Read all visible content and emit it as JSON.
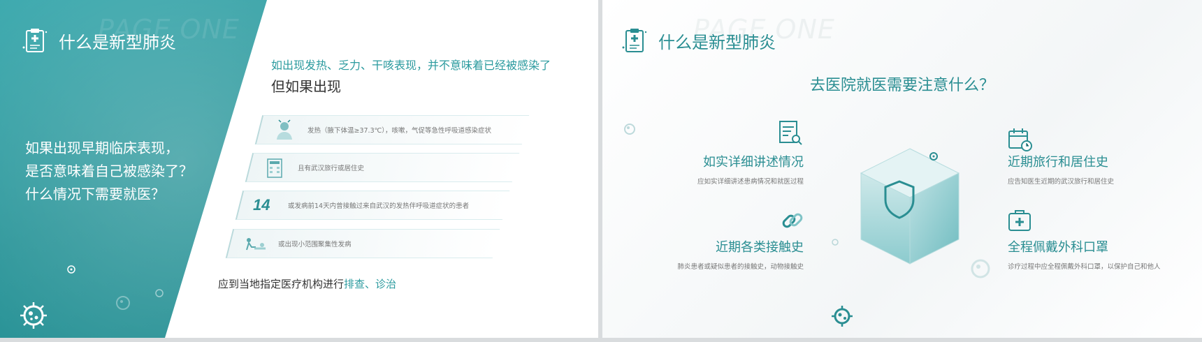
{
  "slide1": {
    "ghost": "PAGE ONE",
    "title": "什么是新型肺炎",
    "question_lines": [
      "如果出现早期临床表现，",
      "是否意味着自己被感染了？",
      "什么情况下需要就医？"
    ],
    "lead_line1": "如出现发热、乏力、干咳表现，并不意味着已经被感染了",
    "lead_line2": "但如果出现",
    "symptoms": [
      {
        "icon": "fever-person-icon",
        "text": "发热（腋下体温≥37.3℃），咳嗽，气促等急性呼吸道感染症状"
      },
      {
        "icon": "hotel-icon",
        "text": "且有武汉旅行或居住史"
      },
      {
        "icon": "number-14-icon",
        "number": "14",
        "text": "或发病前14天内曾接触过来自武汉的发热伴呼吸道症状的患者"
      },
      {
        "icon": "group-patients-icon",
        "text": "或出现小范围聚集性发病"
      }
    ],
    "bottom_prefix": "应到当地指定医疗机构进行",
    "bottom_highlight": "排查、诊治"
  },
  "slide2": {
    "ghost": "PAGE ONE",
    "title": "什么是新型肺炎",
    "center_title": "去医院就医需要注意什么？",
    "blocks": [
      {
        "title": "如实详细讲述情况",
        "desc": "应如实详细讲述患病情况和就医过程",
        "icon": "document-search-icon"
      },
      {
        "title": "近期旅行和居住史",
        "desc": "应告知医生近期的武汉旅行和居住史",
        "icon": "calendar-clock-icon"
      },
      {
        "title": "近期各类接触史",
        "desc": "肺炎患者或疑似患者的接触史，动物接触史",
        "icon": "link-icon"
      },
      {
        "title": "全程佩戴外科口罩",
        "desc": "诊疗过程中应全程佩戴外科口罩，以保护自己和他人",
        "icon": "medical-kit-icon"
      }
    ]
  },
  "colors": {
    "teal": "#2a9599",
    "teal_text": "#2a8e92",
    "accent": "#2a9a9e"
  }
}
